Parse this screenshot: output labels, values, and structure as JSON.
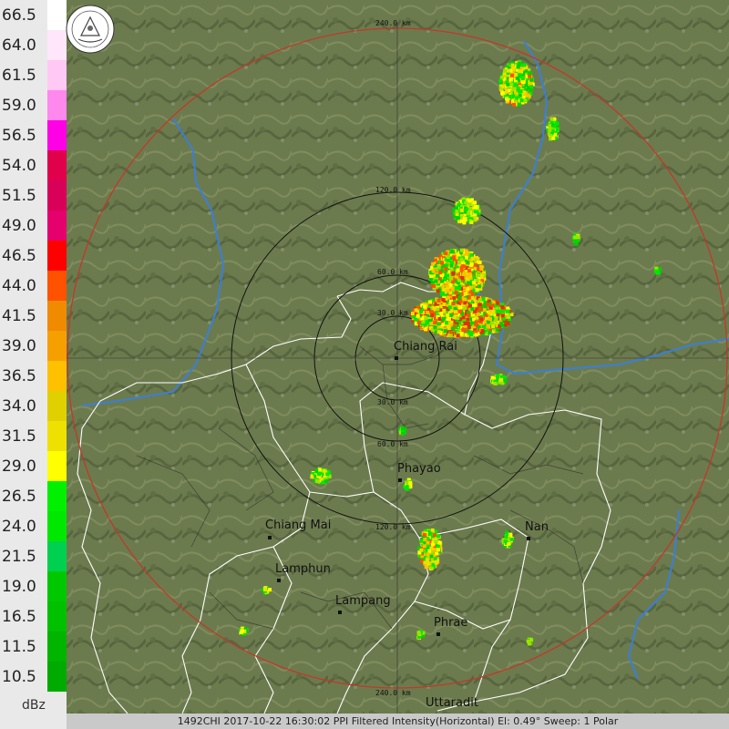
{
  "legend": {
    "unit": "dBz",
    "levels": [
      {
        "label": "66.5",
        "color": "#ffffff"
      },
      {
        "label": "64.0",
        "color": "#ffe6fa"
      },
      {
        "label": "61.5",
        "color": "#ffc8f5"
      },
      {
        "label": "59.0",
        "color": "#ff88ee"
      },
      {
        "label": "56.5",
        "color": "#ff00e6"
      },
      {
        "label": "54.0",
        "color": "#e0004b"
      },
      {
        "label": "51.5",
        "color": "#d9005a"
      },
      {
        "label": "49.0",
        "color": "#e5006e"
      },
      {
        "label": "46.5",
        "color": "#ff0000"
      },
      {
        "label": "44.0",
        "color": "#ff5200"
      },
      {
        "label": "41.5",
        "color": "#f08a00"
      },
      {
        "label": "39.0",
        "color": "#f5a000"
      },
      {
        "label": "36.5",
        "color": "#ffc000"
      },
      {
        "label": "34.0",
        "color": "#e0d000"
      },
      {
        "label": "31.5",
        "color": "#eee000"
      },
      {
        "label": "29.0",
        "color": "#ffff00"
      },
      {
        "label": "26.5",
        "color": "#00f000"
      },
      {
        "label": "24.0",
        "color": "#00e800"
      },
      {
        "label": "21.5",
        "color": "#00d050"
      },
      {
        "label": "19.0",
        "color": "#00c800"
      },
      {
        "label": "16.5",
        "color": "#00c000"
      },
      {
        "label": "11.5",
        "color": "#00b400"
      },
      {
        "label": "10.5",
        "color": "#00aa00"
      }
    ]
  },
  "rings": {
    "r240": "240.0 km",
    "r120": "120.0 km",
    "r60": "60.0 km",
    "r30": "30.0 km",
    "r30b": "30.0 km",
    "r60b": "60.0 km",
    "r120b": "120.0 km",
    "r240b": "240.0 km"
  },
  "cities": {
    "chiang_rai": "Chiang Rai",
    "phayao": "Phayao",
    "chiang_mai": "Chiang Mai",
    "nan": "Nan",
    "lamphun": "Lamphun",
    "lampang": "Lampang",
    "phrae": "Phrae",
    "uttaradit": "Uttaradit"
  },
  "footer": "1492CHI 2017-10-22 16:30:02 PPI Filtered Intensity(Horizontal)  El: 0.49°  Sweep: 1 Polar",
  "colors": {
    "range_outer": "#c0392b",
    "river": "#3a7fd8",
    "border": "#ffffff"
  }
}
